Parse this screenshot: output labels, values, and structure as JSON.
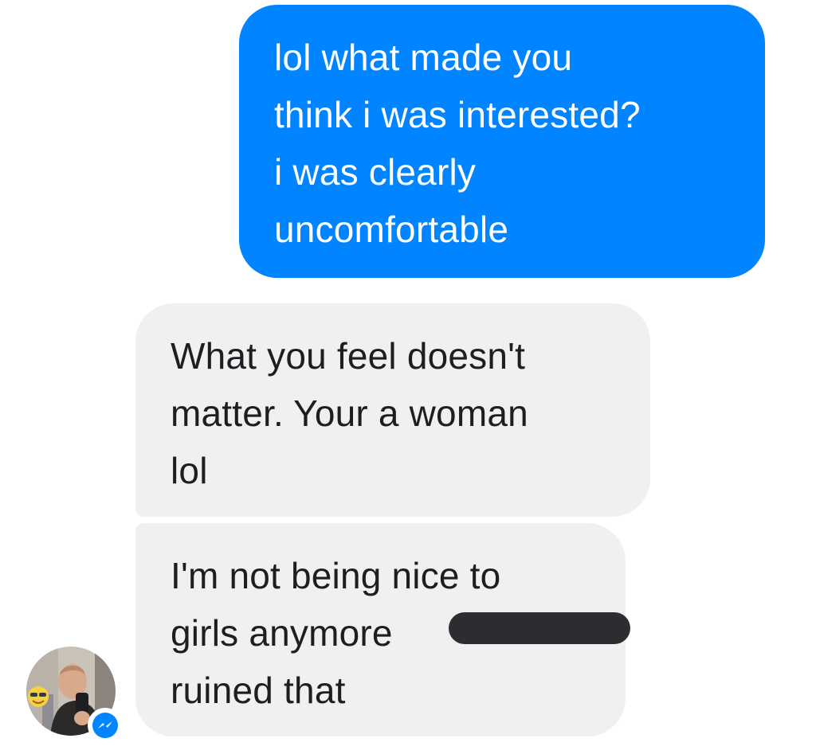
{
  "conversation": {
    "messages": [
      {
        "sender": "me",
        "lines": [
          "lol what made you",
          "think i was interested?",
          "i was clearly",
          "uncomfortable"
        ]
      },
      {
        "sender": "other",
        "lines": [
          "What you feel doesn't",
          "matter. Your a woman",
          "lol"
        ]
      },
      {
        "sender": "other",
        "lines": [
          "I'm not being nice to",
          "girls anymore",
          "ruined that"
        ]
      }
    ]
  },
  "colors": {
    "sent_bubble": "#0084ff",
    "received_bubble": "#f1f0f0",
    "redaction": "#2b2d30",
    "messenger_badge": "#0084ff"
  },
  "icons": {
    "contact_avatar": "avatar-photo",
    "platform_badge": "messenger-icon"
  }
}
